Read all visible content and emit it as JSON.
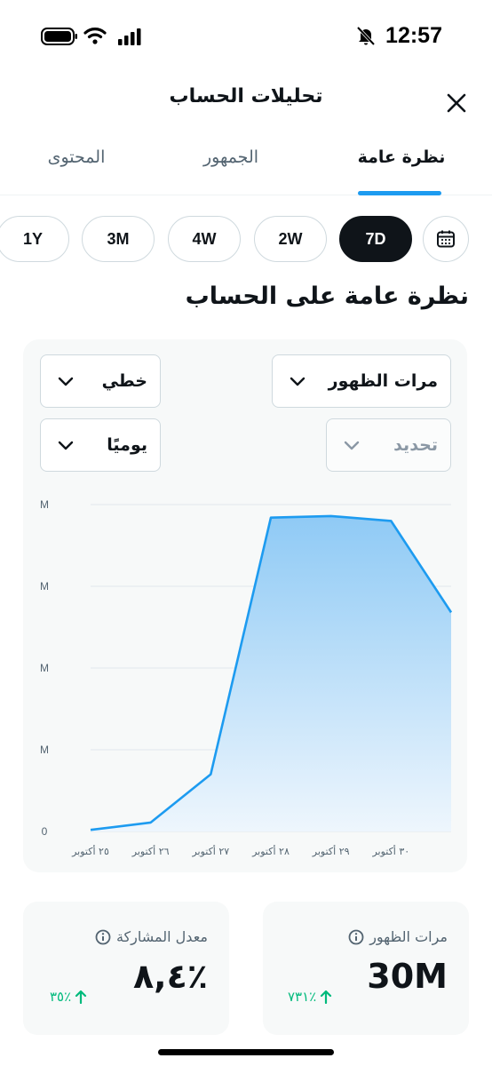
{
  "status_bar": {
    "time": "12:57"
  },
  "header": {
    "title": "تحليلات الحساب"
  },
  "tabs": [
    {
      "label": "نظرة عامة",
      "active": true
    },
    {
      "label": "الجمهور",
      "active": false
    },
    {
      "label": "المحتوى",
      "active": false
    }
  ],
  "ranges": [
    {
      "label": "7D",
      "active": true
    },
    {
      "label": "2W",
      "active": false
    },
    {
      "label": "4W",
      "active": false
    },
    {
      "label": "3M",
      "active": false
    },
    {
      "label": "1Y",
      "active": false
    }
  ],
  "section_title": "نظرة عامة على الحساب",
  "chart_controls": {
    "metric": "مرات الظهور",
    "style": "خطي",
    "compare": "تحديد",
    "interval": "يوميًا"
  },
  "chart_data": {
    "type": "area",
    "x": [
      "٢٥ أكتوبر",
      "٢٦ أكتوبر",
      "٢٧ أكتوبر",
      "٢٨ أكتوبر",
      "٢٩ أكتوبر",
      "٣٠ أكتوبر",
      ""
    ],
    "y_tick_labels": [
      "0",
      "M",
      "M",
      "M",
      "M"
    ],
    "values": [
      0.1,
      0.55,
      3.5,
      19.2,
      19.3,
      19.0,
      13.4
    ],
    "ylim": [
      0,
      20
    ],
    "line_color": "#1d9bf0",
    "fill_color_top": "#8fcaf5",
    "fill_color_bottom": "#eef6fd",
    "grid": true
  },
  "stats": [
    {
      "label": "مرات الظهور",
      "value": "30M",
      "change": "٧٣١٪"
    },
    {
      "label": "معدل المشاركة",
      "value": "٨,٤٪",
      "change": "٣٥٪"
    }
  ],
  "colors": {
    "accent": "#1d9bf0",
    "positive": "#00ba7c",
    "text": "#0f1419",
    "muted": "#536471"
  }
}
